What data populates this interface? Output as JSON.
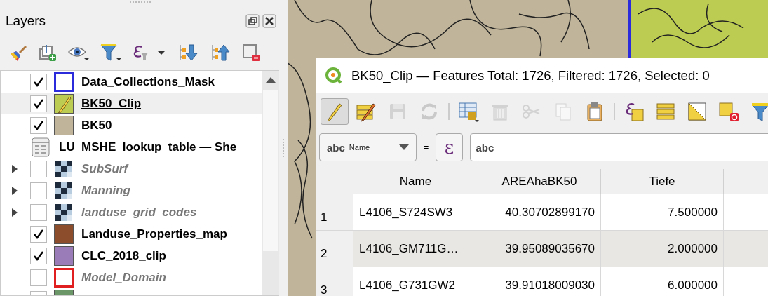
{
  "layers_panel": {
    "title": "Layers",
    "items": [
      {
        "kind": "outline",
        "label": "Data_Collections_Mask",
        "checked": true,
        "selected": false,
        "color": "#2b2bdc"
      },
      {
        "kind": "edit",
        "label": "BK50_Clip",
        "checked": true,
        "selected": true,
        "color": "#bccc52"
      },
      {
        "kind": "fill",
        "label": "BK50",
        "checked": true,
        "selected": false,
        "color": "#c0b59a"
      },
      {
        "kind": "table",
        "label": "LU_MSHE_lookup_table — She",
        "selected": false
      },
      {
        "kind": "raster",
        "label": "SubSurf",
        "checked": false,
        "selected": false,
        "expanded": false
      },
      {
        "kind": "raster",
        "label": "Manning",
        "checked": false,
        "selected": false,
        "expanded": false
      },
      {
        "kind": "raster",
        "label": "landuse_grid_codes",
        "checked": false,
        "selected": false,
        "expanded": false
      },
      {
        "kind": "fill",
        "label": "Landuse_Properties_map",
        "checked": true,
        "selected": false,
        "color": "#8b4d2c"
      },
      {
        "kind": "fill",
        "label": "CLC_2018_clip",
        "checked": true,
        "selected": false,
        "color": "#9a7cb8"
      },
      {
        "kind": "outline",
        "label": "Model_Domain",
        "checked": false,
        "selected": false,
        "color": "#e02020"
      },
      {
        "kind": "fill",
        "selected": false,
        "color": "#6a9668"
      }
    ]
  },
  "attribute_table": {
    "title": "BK50_Clip — Features Total: 1726, Filtered: 1726, Selected: 0",
    "toolbar": [
      {
        "kind": "toggle-edit",
        "pressed": true,
        "disabled": false
      },
      {
        "kind": "multi-edit",
        "pressed": false,
        "disabled": false
      },
      {
        "kind": "save",
        "pressed": false,
        "disabled": true
      },
      {
        "kind": "reload",
        "pressed": false,
        "disabled": true
      },
      {
        "kind": "separator"
      },
      {
        "kind": "add-feature",
        "pressed": false,
        "disabled": false
      },
      {
        "kind": "delete",
        "pressed": false,
        "disabled": true
      },
      {
        "kind": "cut",
        "pressed": false,
        "disabled": true
      },
      {
        "kind": "copy",
        "pressed": false,
        "disabled": true
      },
      {
        "kind": "paste",
        "pressed": false,
        "disabled": false
      },
      {
        "kind": "separator"
      },
      {
        "kind": "select-expression",
        "pressed": false,
        "disabled": false
      },
      {
        "kind": "select-all",
        "pressed": false,
        "disabled": false
      },
      {
        "kind": "invert",
        "pressed": false,
        "disabled": false
      },
      {
        "kind": "deselect",
        "pressed": false,
        "disabled": false
      },
      {
        "kind": "filter",
        "pressed": false,
        "disabled": false
      }
    ],
    "filter": {
      "field_type": "abc",
      "field": "Name",
      "operator": "=",
      "expression_button": "ε",
      "value_type": "abc"
    },
    "columns": [
      "Name",
      "AREAhaBK50",
      "Tiefe"
    ],
    "rows": [
      {
        "header": "1",
        "cells": [
          "L4106_S724SW3",
          "40.30702899170",
          "7.500000"
        ]
      },
      {
        "header": "2",
        "cells": [
          "L4106_GM711G…",
          "39.95089035670",
          "2.000000"
        ]
      },
      {
        "header": "3",
        "cells": [
          "L4106_G731GW2",
          "39.91018009030",
          "6.000000"
        ]
      }
    ]
  }
}
